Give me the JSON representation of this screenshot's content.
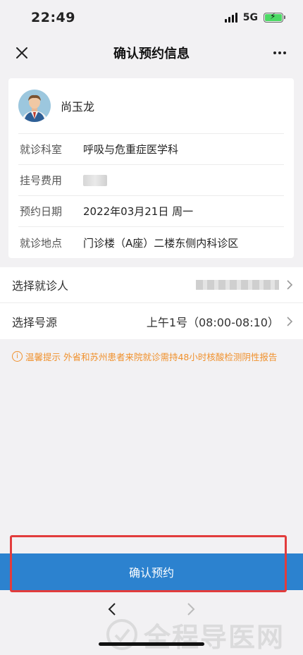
{
  "status_bar": {
    "time": "22:49",
    "network": "5G",
    "icons": [
      "signal-icon",
      "battery-charging-icon"
    ]
  },
  "nav": {
    "title": "确认预约信息",
    "close_icon": "close-icon",
    "more_icon": "more-icon"
  },
  "doctor": {
    "name": "尚玉龙"
  },
  "info_rows": [
    {
      "label": "就诊科室",
      "value": "呼吸与危重症医学科"
    },
    {
      "label": "挂号费用",
      "value": ""
    },
    {
      "label": "预约日期",
      "value": "2022年03月21日 周一"
    },
    {
      "label": "就诊地点",
      "value": "门诊楼（A座）二楼东侧内科诊区"
    }
  ],
  "select_rows": [
    {
      "label": "选择就诊人",
      "value": ""
    },
    {
      "label": "选择号源",
      "value": "上午1号（08:00-08:10）"
    }
  ],
  "tip": {
    "icon": "info-icon",
    "text": "温馨提示 外省和苏州患者来院就诊需持48小时核酸检测阴性报告"
  },
  "confirm_button": {
    "label": "确认预约"
  },
  "browser_nav": {
    "back_icon": "back-arrow-icon",
    "forward_icon": "forward-arrow-icon"
  },
  "watermark": {
    "text": "全程导医网"
  },
  "colors": {
    "accent": "#2c82cf",
    "tip": "#f0912d",
    "highlight": "#e23c3c",
    "background": "#f2f1f3"
  }
}
